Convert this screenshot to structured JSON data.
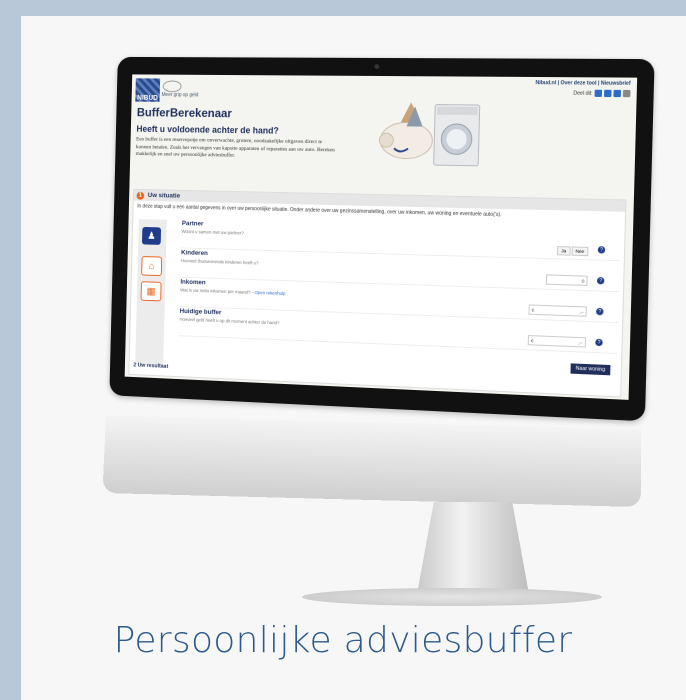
{
  "caption": "Persoonlijke adviesbuffer",
  "site": {
    "logo_text": "NIBUD",
    "slogan": "Meer grip op geld",
    "top_nav": "Nibud.nl | Over deze tool | Nieuwsbrief",
    "share_label": "Deel dit:"
  },
  "page": {
    "title": "BufferBerekenaar",
    "subtitle": "Heeft u voldoende achter de hand?",
    "intro": "Een buffer is een reservepotje om onverwachte, grotere, noodzakelijke uitgaven direct te kunnen betalen. Zoals het vervangen van kapotte apparaten of reparaties aan uw auto. Bereken makkelijk en snel uw persoonlijke adviesbuffer."
  },
  "step1": {
    "number": "1",
    "heading": "Uw situatie",
    "text": "In deze stap vult u een aantal gegevens in over uw persoonlijke situatie. Onder andere over uw gezinssamenstelling, over uw inkomen, uw woning en eventuele auto('s)."
  },
  "rows": [
    {
      "title": "Partner",
      "hint": "Woont u samen met uw partner?",
      "options": [
        "Ja",
        "Nee"
      ]
    },
    {
      "title": "Kinderen",
      "hint": "Hoeveel thuiswonende kinderen heeft u?",
      "value": "0"
    },
    {
      "title": "Inkomen",
      "hint": "Wat is uw netto inkomen per maand?",
      "link": "Open rekenhulp",
      "prefix": "€",
      "suffix": ",--"
    },
    {
      "title": "Huidige buffer",
      "hint": "Hoeveel geld heeft u op dit moment achter de hand?",
      "prefix": "€",
      "suffix": ",--"
    }
  ],
  "next_button": "Naar woning",
  "step2": "2  Uw resultaat"
}
